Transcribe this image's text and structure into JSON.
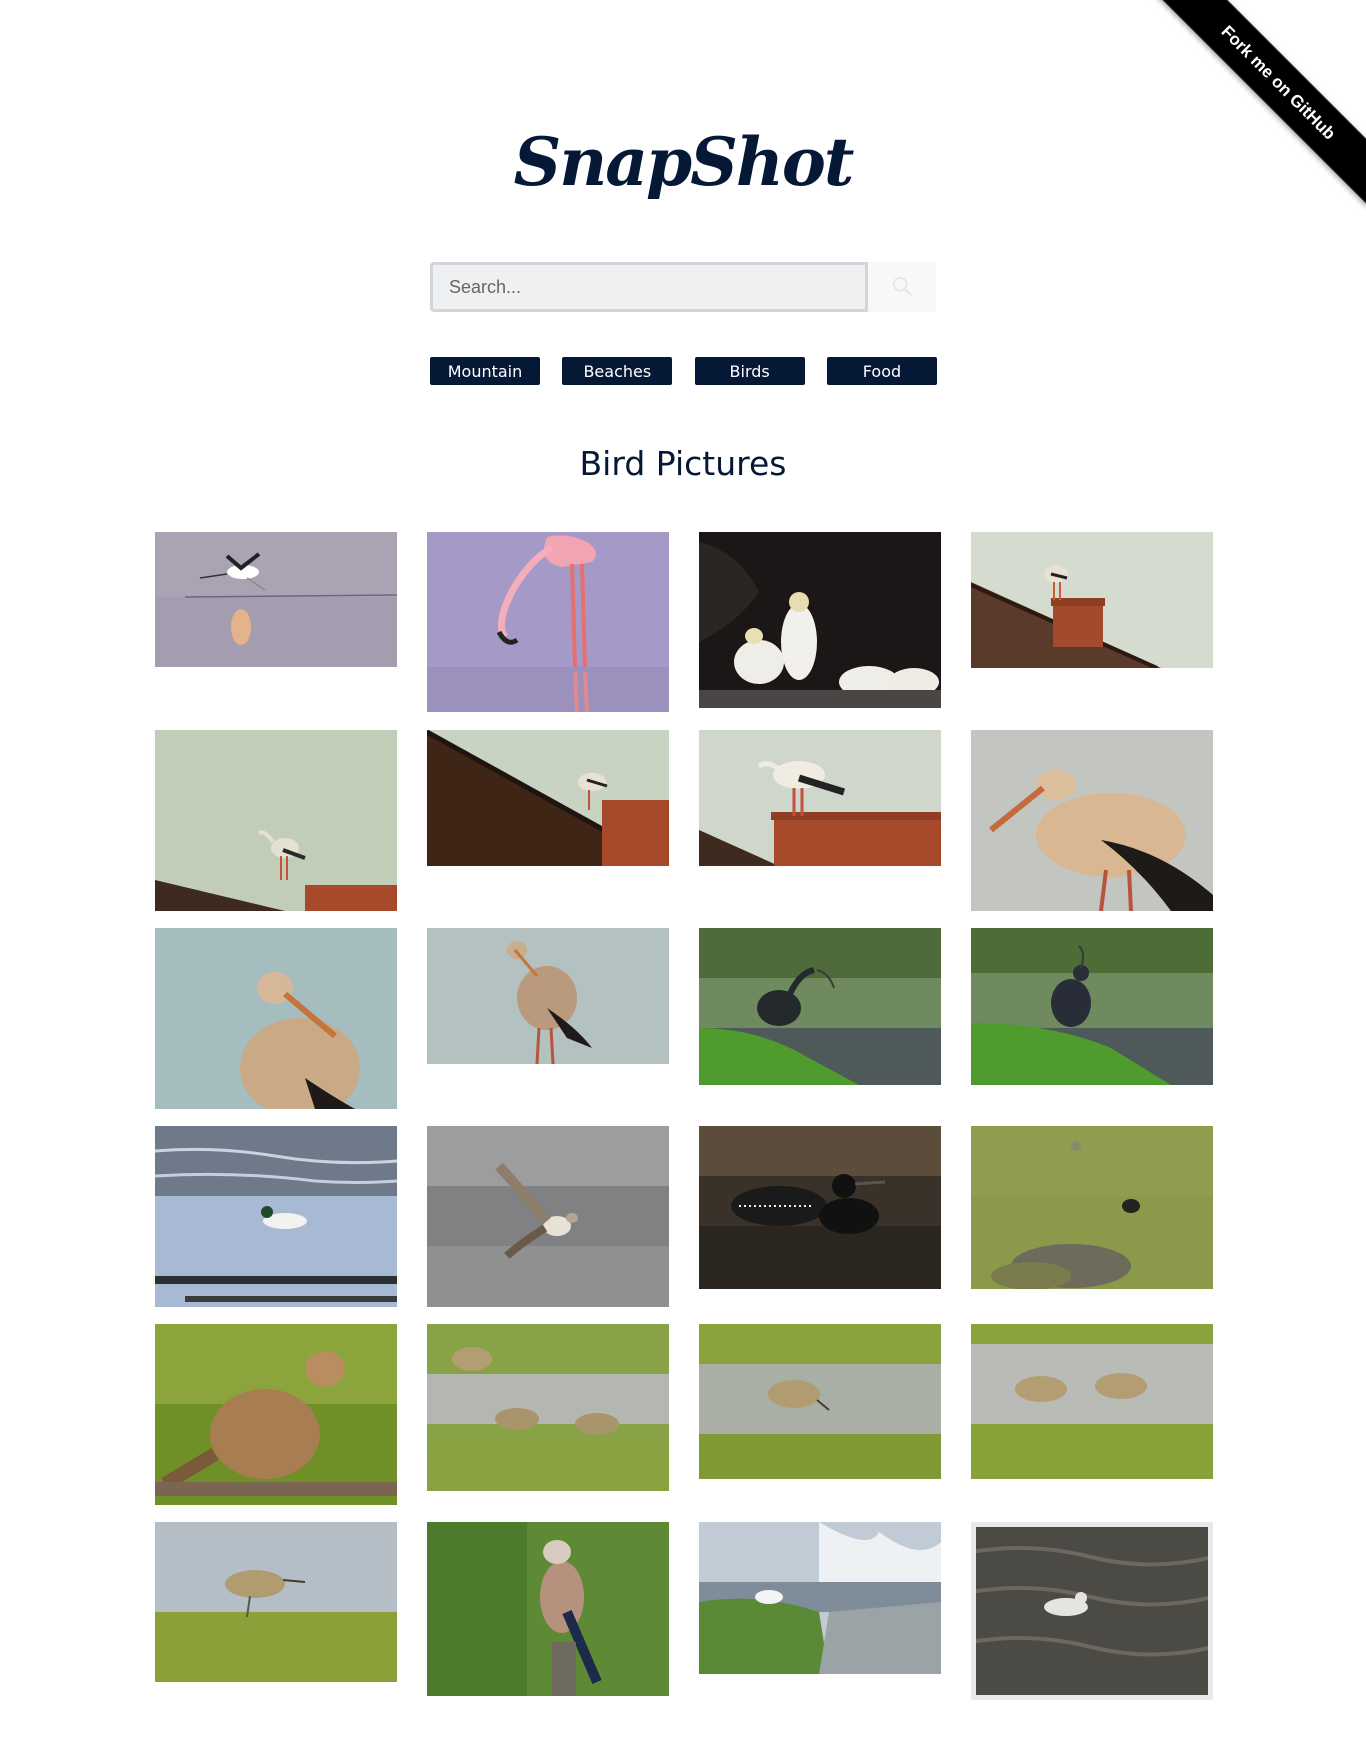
{
  "ribbon": {
    "label": "Fork me on GitHub"
  },
  "logo": {
    "text": "SnapShot"
  },
  "search": {
    "placeholder": "Search...",
    "icon": "search-icon"
  },
  "categories": [
    {
      "label": "Mountain"
    },
    {
      "label": "Beaches"
    },
    {
      "label": "Birds"
    },
    {
      "label": "Food"
    }
  ],
  "section": {
    "title": "Bird Pictures"
  },
  "colors": {
    "brand": "#051937",
    "ribbon": "#000000",
    "search_bg": "#eef0f2"
  },
  "gallery": {
    "photos": [
      {
        "subject": "avocet-flying-over-water"
      },
      {
        "subject": "flamingo-feeding"
      },
      {
        "subject": "gannets-pair"
      },
      {
        "subject": "stork-on-roof"
      },
      {
        "subject": "stork-on-roof-sky"
      },
      {
        "subject": "stork-on-roof-edge"
      },
      {
        "subject": "stork-on-chimney"
      },
      {
        "subject": "stork-closeup"
      },
      {
        "subject": "stork-portrait"
      },
      {
        "subject": "stork-standing"
      },
      {
        "subject": "ibis-on-grass"
      },
      {
        "subject": "ibis-on-grass-back"
      },
      {
        "subject": "duck-swimming"
      },
      {
        "subject": "sandpiper-flying"
      },
      {
        "subject": "loon-on-water"
      },
      {
        "subject": "bird-in-field"
      },
      {
        "subject": "kestrel-perched"
      },
      {
        "subject": "sandpipers-wading"
      },
      {
        "subject": "sandpiper-feeding"
      },
      {
        "subject": "sandpipers-pair"
      },
      {
        "subject": "sandpiper-shore"
      },
      {
        "subject": "jay-on-post"
      },
      {
        "subject": "gull-on-rock"
      },
      {
        "subject": "gull-on-waves"
      }
    ]
  }
}
